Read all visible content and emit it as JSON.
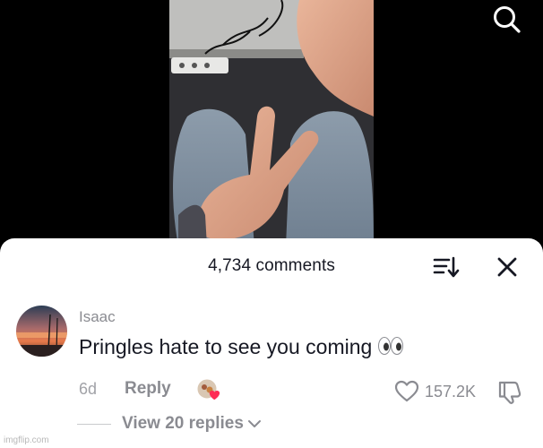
{
  "header": {
    "comment_count": "4,734 comments"
  },
  "icons": {
    "search": "search-icon",
    "sort": "sort-icon",
    "close": "close-icon",
    "like": "heart-outline-icon",
    "dislike": "thumbs-down-icon",
    "chevron": "chevron-down-icon"
  },
  "comment": {
    "username": "Isaac",
    "text": "Pringles hate to see you coming",
    "age": "6d",
    "reply_label": "Reply",
    "likes": "157.2K",
    "view_replies": "View 20 replies"
  },
  "watermark": "imgflip.com",
  "colors": {
    "sheet_bg": "#ffffff",
    "text_primary": "#161823",
    "text_secondary": "#8a8b91",
    "creator_heart": "#fe2c55"
  }
}
